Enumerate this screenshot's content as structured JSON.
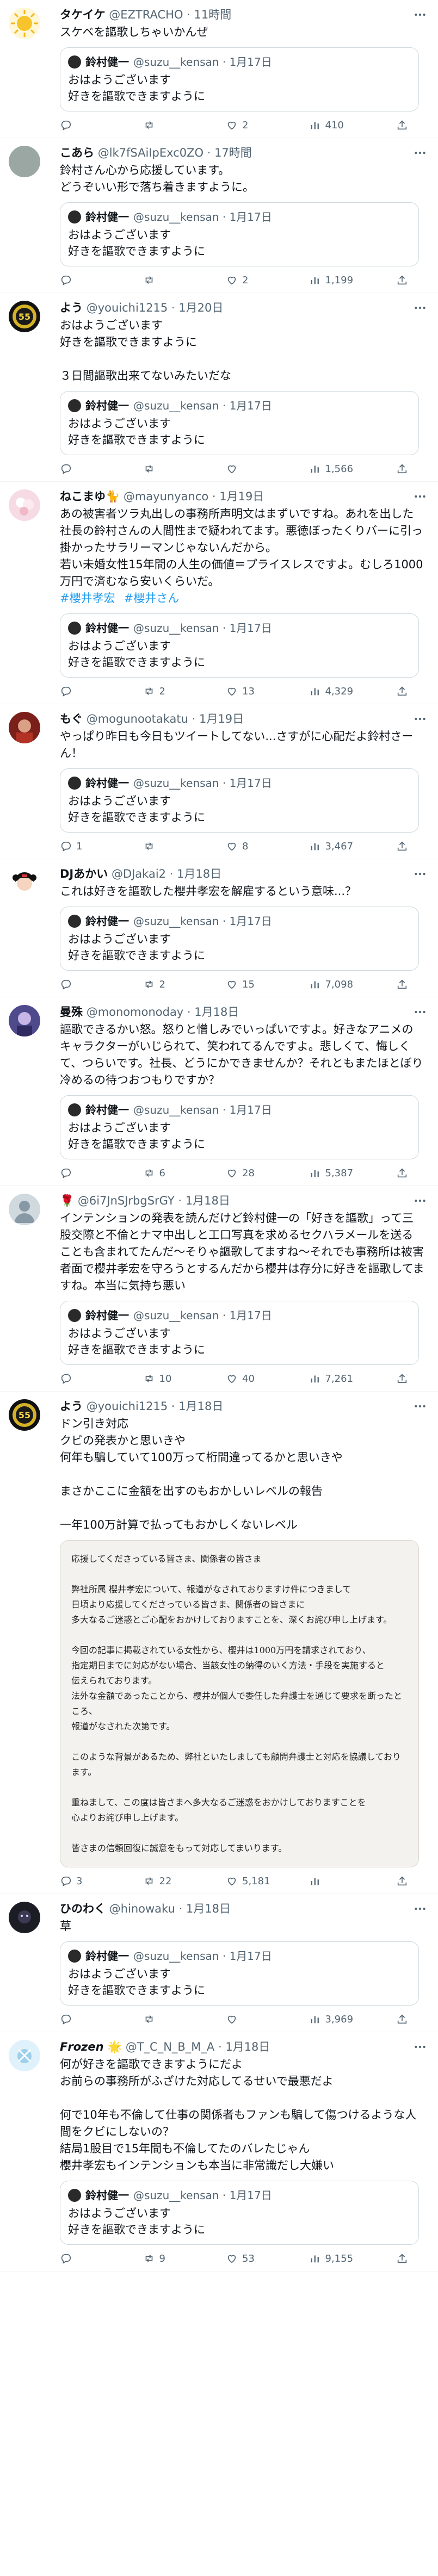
{
  "quoted": {
    "name": "鈴村健一",
    "handle": "@suzu__kensan",
    "date": "1月17日",
    "text": "おはようございます\n好きを謳歌できますように"
  },
  "icons": {
    "more": "more-icon",
    "reply": "reply-icon",
    "retweet": "retweet-icon",
    "like": "like-icon",
    "views": "views-icon",
    "share": "share-icon"
  },
  "colors": {
    "link": "#1d9bf0",
    "secondary": "#536471",
    "border": "#eff3f4"
  },
  "tweets": [
    {
      "name": "タケイケ",
      "handle": "@EZTRACHO",
      "time": "11時間",
      "text": "スケベを謳歌しちゃいかんぜ",
      "reply": "",
      "retweet": "",
      "like": "2",
      "views": "410",
      "avatar": "sun"
    },
    {
      "name": "こあら",
      "handle": "@lk7fSAiIpExc0ZO",
      "time": "17時間",
      "text": "鈴村さん心から応援しています。\nどうぞいい形で落ち着きますように。",
      "reply": "",
      "retweet": "",
      "like": "2",
      "views": "1,199",
      "avatar": "plain"
    },
    {
      "name": "よう",
      "handle": "@youichi1215",
      "time": "1月20日",
      "text": "おはようございます\n好きを謳歌できますように\n\n３日間謳歌出来てないみたいだな",
      "reply": "",
      "retweet": "",
      "like": "",
      "views": "1,566",
      "avatar": "badge"
    },
    {
      "name": "ねこまゆ🐈",
      "handle": "@mayunyanco",
      "time": "1月19日",
      "text": "あの被害者ツラ丸出しの事務所声明文はまずいですね。あれを出した社長の鈴村さんの人間性まで疑われてます。悪徳ぼったくりバーに引っ掛かったサラリーマンじゃないんだから。\n若い未婚女性15年間の人生の価値＝プライスレスですよ。むしろ1000万円で済むなら安いくらいだ。",
      "hashtags": [
        "#櫻井孝宏",
        "#櫻井さん"
      ],
      "reply": "",
      "retweet": "2",
      "like": "13",
      "views": "4,329",
      "avatar": "pink"
    },
    {
      "name": "もぐ",
      "handle": "@mogunootakatu",
      "time": "1月19日",
      "text": "やっぱり昨日も今日もツイートしてない...さすがに心配だよ鈴村さーん！",
      "reply": "1",
      "retweet": "",
      "like": "8",
      "views": "3,467",
      "avatar": "red"
    },
    {
      "name": "DJあかい",
      "handle": "@DJakai2",
      "time": "1月18日",
      "text": "これは好きを謳歌した櫻井孝宏を解雇するという意味...？",
      "reply": "",
      "retweet": "2",
      "like": "15",
      "views": "7,098",
      "avatar": "girl"
    },
    {
      "name": "曼殊",
      "handle": "@monomonoday",
      "time": "1月18日",
      "text": "謳歌できるかい怒。怒りと憎しみでいっぱいですよ。好きなアニメのキャラクターがいじられて、笑われてるんですよ。悲しくて、悔しくて、つらいです。社長、どうにかできませんか？それともまたほとぼり冷めるの待つおつもりですか？",
      "reply": "",
      "retweet": "6",
      "like": "28",
      "views": "5,387",
      "avatar": "purple"
    },
    {
      "name": "🌹",
      "handle": "@6i7JnSJrbgSrGY",
      "time": "1月18日",
      "text": "インテンションの発表を読んだけど鈴村健一の「好きを謳歌」って三股交際と不倫とナマ中出しと工口写真を求めるセクハラメールを送ることも含まれてたんだ〜そりゃ謳歌してますね〜それでも事務所は被害者面で櫻井孝宏を守ろうとするんだから櫻井は存分に好きを謳歌してますね。本当に気持ち悪い",
      "reply": "",
      "retweet": "10",
      "like": "40",
      "views": "7,261",
      "avatar": "gray"
    },
    {
      "name": "よう",
      "handle": "@youichi1215",
      "time": "1月18日",
      "text": "ドン引き対応\nクビの発表かと思いきや\n何年も騙していて100万って桁間違ってるかと思いきや\n\nまさかここに金額を出すのもおかしいレベルの報告\n\n一年100万計算で払ってもおかしくないレベル",
      "doc": "応援してくださっている皆さま、関係者の皆さま\n\n弊社所属 櫻井孝宏について、報道がなされておりますけ件につきまして\n日頃より応援してくださっている皆さま、関係者の皆さまに\n多大なるご迷惑とご心配をおかけしておりますことを、深くお詫び申し上げます。\n\n今回の記事に掲載されている女性から、櫻井は1000万円を請求されており、\n指定期日までに対応がない場合、当該女性の納得のいく方法・手段を実施すると\n伝えられております。\n法外な金額であったことから、櫻井が個人で委任した弁護士を通じて要求を断ったところ、\n報道がなされた次第です。\n\nこのような背景があるため、弊社といたしましても顧問弁護士と対応を協議しております。\n\n重ねまして、この度は皆さまへ多大なるご迷惑をおかけしておりますことを\n心よりお詫び申し上げます。\n\n皆さまの信頼回復に誠意をもって対応してまいります。",
      "reply": "3",
      "retweet": "22",
      "like": "5,181",
      "views": "",
      "avatar": "badge"
    },
    {
      "name": "ひのわく",
      "handle": "@hinowaku",
      "time": "1月18日",
      "text": "草",
      "reply": "",
      "retweet": "",
      "like": "",
      "views": "3,969",
      "avatar": "dark"
    },
    {
      "name": "𝙁𝙧𝙤𝙯𝙚𝙣 🌟",
      "handle": "@T_C_N_B_M_A",
      "time": "1月18日",
      "text": "何が好きを謳歌できますようにだよ\nお前らの事務所がふざけた対応してるせいで最悪だよ\n\n何で10年も不倫して仕事の関係者もファンも騙して傷つけるような人間をクビにしないの？\n結局1股目で15年間も不倫してたのバレたじゃん\n櫻井孝宏もインテンションも本当に非常識だし大嫌い",
      "reply": "",
      "retweet": "9",
      "like": "53",
      "views": "9,155",
      "avatar": "ice"
    }
  ]
}
